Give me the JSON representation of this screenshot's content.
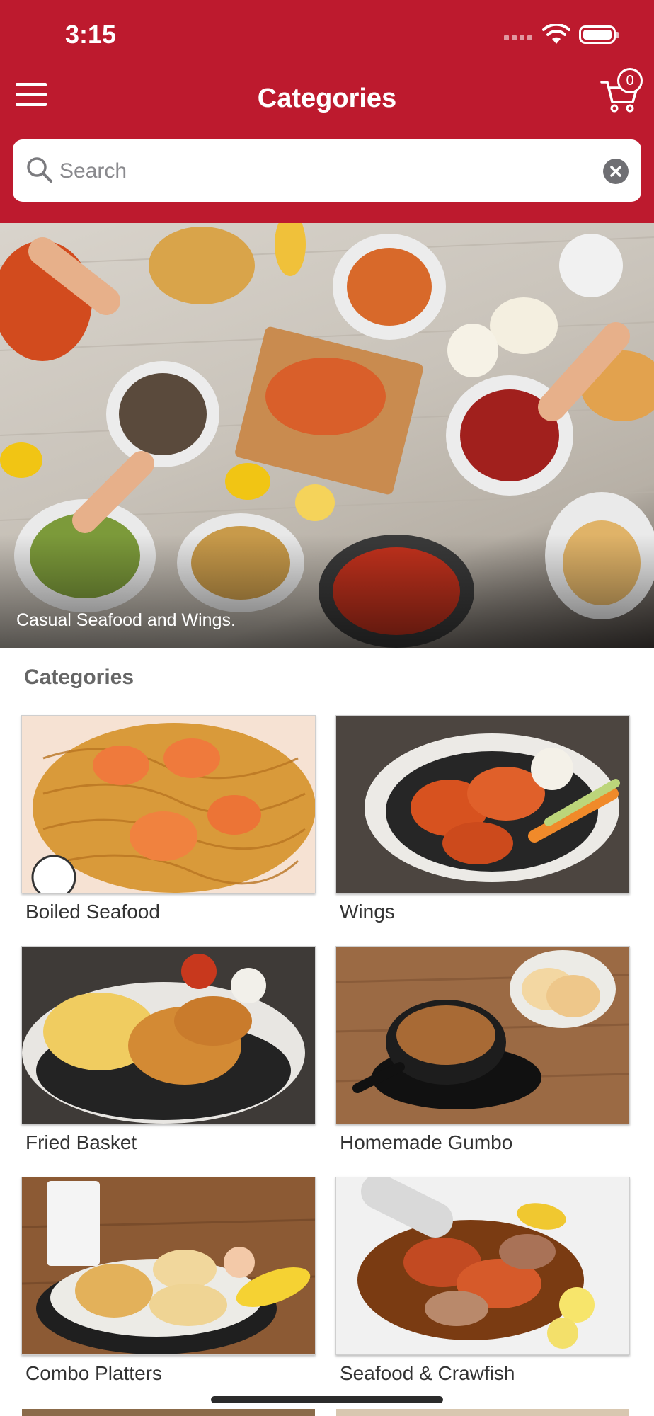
{
  "status_bar": {
    "time": "3:15"
  },
  "header": {
    "title": "Categories",
    "cart_count": "0"
  },
  "search": {
    "placeholder": "Search",
    "value": ""
  },
  "hero": {
    "caption": "Casual Seafood and Wings."
  },
  "categories_section": {
    "title": "Categories"
  },
  "categories": [
    {
      "label": "Boiled Seafood"
    },
    {
      "label": "Wings"
    },
    {
      "label": "Fried Basket"
    },
    {
      "label": "Homemade Gumbo"
    },
    {
      "label": "Combo Platters"
    },
    {
      "label": "Seafood & Crawfish"
    }
  ],
  "colors": {
    "brand": "#bd1a2e",
    "background": "#ffffff",
    "section_text": "#666666"
  },
  "icons": [
    "menu-icon",
    "cart-icon",
    "search-icon",
    "clear-icon"
  ]
}
